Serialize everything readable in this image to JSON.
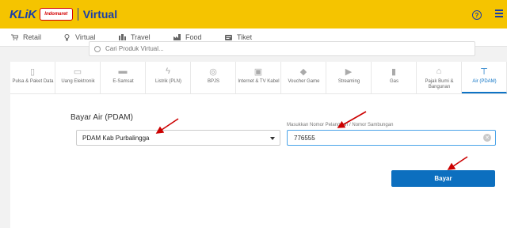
{
  "header": {
    "logo_text": "KLiK",
    "logo_brand": "Indomaret",
    "title": "Virtual",
    "help_icon": "help-circle-icon",
    "menu_icon": "hamburger-menu-icon"
  },
  "nav": [
    {
      "label": "Retail",
      "icon": "cart-icon"
    },
    {
      "label": "Virtual",
      "icon": "lightbulb-icon"
    },
    {
      "label": "Travel",
      "icon": "building-icon"
    },
    {
      "label": "Food",
      "icon": "factory-icon"
    },
    {
      "label": "Tiket",
      "icon": "ticket-icon"
    }
  ],
  "search": {
    "placeholder": "Cari Produk Virtual..."
  },
  "categories": [
    {
      "label": "Pulsa & Paket Data",
      "icon": "phone-icon"
    },
    {
      "label": "Uang Elektronik",
      "icon": "money-icon"
    },
    {
      "label": "E-Samsat",
      "icon": "car-icon"
    },
    {
      "label": "Listrik (PLN)",
      "icon": "lightning-icon"
    },
    {
      "label": "BPJS",
      "icon": "shield-icon"
    },
    {
      "label": "Internet & TV Kabel",
      "icon": "tv-icon"
    },
    {
      "label": "Voucher Game",
      "icon": "gamepad-icon"
    },
    {
      "label": "Streaming",
      "icon": "play-icon"
    },
    {
      "label": "Gas",
      "icon": "gas-icon"
    },
    {
      "label": "Pajak Bumi & Bangunan",
      "icon": "house-icon"
    },
    {
      "label": "Air (PDAM)",
      "icon": "faucet-icon",
      "active": true
    }
  ],
  "form": {
    "title": "Bayar Air (PDAM)",
    "region_value": "PDAM Kab Purbalingga",
    "customer_label": "Masukkan Nomor Pelanggan / Nomor Sambungan",
    "customer_value": "776555",
    "pay_label": "Bayar"
  },
  "colors": {
    "accent": "#f5c400",
    "primary": "#0c6fbf",
    "annotation": "#cc0000"
  }
}
